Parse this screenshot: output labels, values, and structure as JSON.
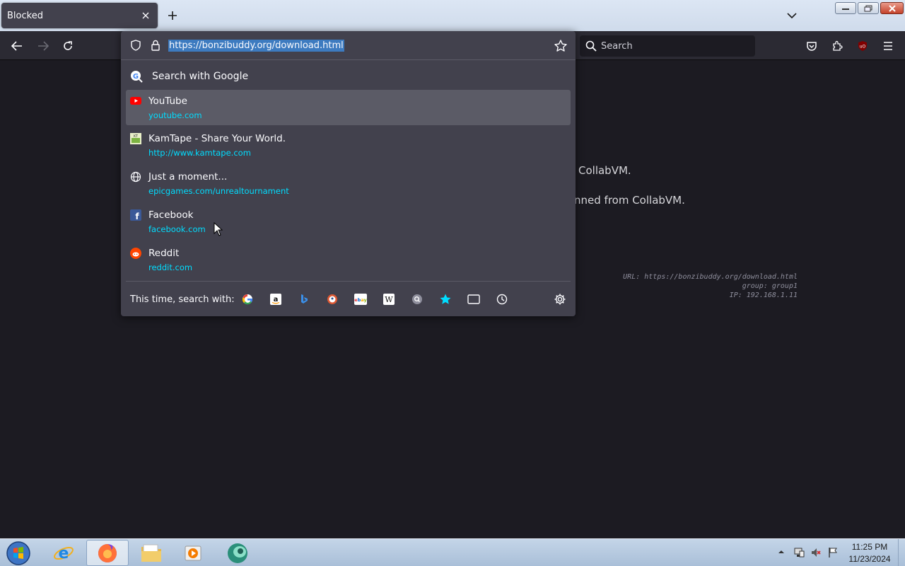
{
  "tab": {
    "title": "Blocked"
  },
  "toolbar": {
    "search_placeholder": "Search"
  },
  "urlbar": {
    "url": "https://bonzibuddy.org/download.html"
  },
  "dropdown": {
    "search_with": "Search with Google",
    "results": [
      {
        "title": "YouTube",
        "url": "youtube.com",
        "icon": "youtube-icon"
      },
      {
        "title": "KamTape - Share Your World.",
        "url": "http://www.kamtape.com",
        "icon": "kamtape-icon"
      },
      {
        "title": "Just a moment...",
        "url": "epicgames.com/unrealtournament",
        "icon": "globe-icon"
      },
      {
        "title": "Facebook",
        "url": "facebook.com",
        "icon": "facebook-icon"
      },
      {
        "title": "Reddit",
        "url": "reddit.com",
        "icon": "reddit-icon"
      }
    ],
    "oneoff_label": "This time, search with:",
    "engines": [
      "google-icon",
      "amazon-icon",
      "bing-icon",
      "duckduckgo-icon",
      "ebay-icon",
      "wikipedia-icon",
      "search-engine-icon",
      "bookmarks-icon",
      "tabs-icon",
      "history-icon"
    ]
  },
  "page": {
    "line1": "CollabVM.",
    "line2": "nned from CollabVM.",
    "info_url": "URL: https://bonzibuddy.org/download.html",
    "info_group": "group: group1",
    "info_ip": "IP: 192.168.1.11"
  },
  "taskbar": {
    "time": "11:25 PM",
    "date": "11/23/2024"
  },
  "colors": {
    "accent_link": "#00ddff",
    "selection": "#3d7bc0",
    "panel": "#42414d",
    "toolbar": "#2b2a33"
  }
}
